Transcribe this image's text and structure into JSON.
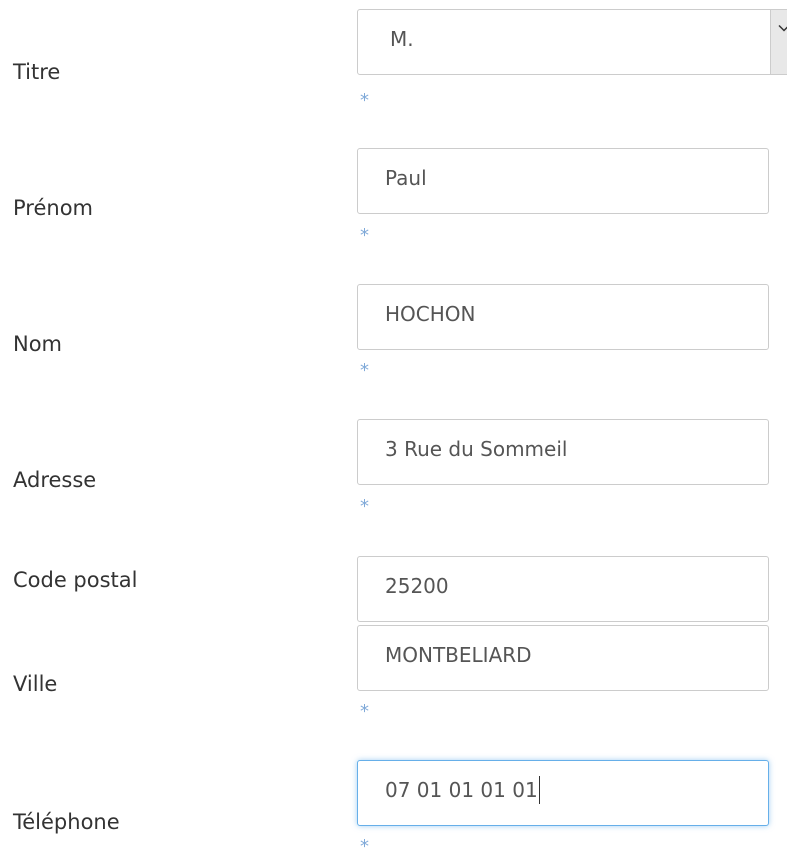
{
  "form": {
    "titre": {
      "label": "Titre",
      "value": "M.",
      "required_mark": "*"
    },
    "prenom": {
      "label": "Prénom",
      "value": "Paul",
      "required_mark": "*"
    },
    "nom": {
      "label": "Nom",
      "value": "HOCHON",
      "required_mark": "*"
    },
    "adresse": {
      "label": "Adresse",
      "value": "3 Rue du Sommeil",
      "required_mark": "*"
    },
    "code_postal": {
      "label": "Code postal",
      "value": "25200"
    },
    "ville": {
      "label": "Ville",
      "value": "MONTBELIARD",
      "required_mark": "*"
    },
    "telephone": {
      "label": "Téléphone",
      "value": "07 01 01 01 01",
      "required_mark": "*"
    }
  },
  "icons": {
    "select_arrow": "chevron-down-icon"
  },
  "colors": {
    "required_mark": "#7fa9d8",
    "focus_border": "#66afe9",
    "field_border": "#cccccc"
  }
}
